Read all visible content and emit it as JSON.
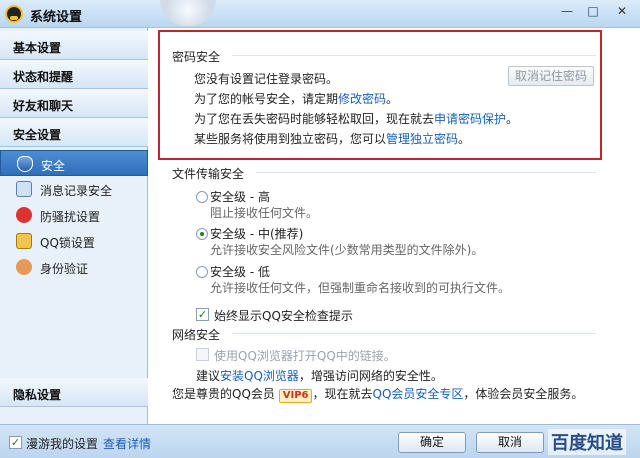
{
  "window": {
    "title": "系统设置",
    "minimize": "—",
    "maximize": "□",
    "close": "✕"
  },
  "sidebar": {
    "categories": [
      {
        "label": "基本设置"
      },
      {
        "label": "状态和提醒"
      },
      {
        "label": "好友和聊天"
      },
      {
        "label": "安全设置"
      }
    ],
    "items": [
      {
        "label": "安全",
        "icon": "shield-icon",
        "selected": true
      },
      {
        "label": "消息记录安全",
        "icon": "message-log-icon"
      },
      {
        "label": "防骚扰设置",
        "icon": "anti-harass-icon"
      },
      {
        "label": "QQ锁设置",
        "icon": "lock-icon"
      },
      {
        "label": "身份验证",
        "icon": "user-verify-icon"
      }
    ],
    "privacy": "隐私设置"
  },
  "password": {
    "title": "密码安全",
    "line1": "您没有设置记住登录密码。",
    "cancel_button": "取消记住密码",
    "line2_pre": "为了您的帐号安全，请定期",
    "line2_link": "修改密码",
    "line2_post": "。",
    "line3_pre": "为了您在丢失密码时能够轻松取回，现在就去",
    "line3_link": "申请密码保护",
    "line3_post": "。",
    "line4_pre": "某些服务将使用到独立密码，您可以",
    "line4_link": "管理独立密码",
    "line4_post": "。"
  },
  "file_transfer": {
    "title": "文件传输安全",
    "options": [
      {
        "label": "安全级 - 高",
        "desc": "阻止接收任何文件。",
        "selected": false
      },
      {
        "label": "安全级 - 中(推荐)",
        "desc": "允许接收安全风险文件(少数常用类型的文件除外)。",
        "selected": true
      },
      {
        "label": "安全级 - 低",
        "desc": "允许接收任何文件，但强制重命名接收到的可执行文件。",
        "selected": false
      }
    ],
    "always_show": "始终显示QQ安全检查提示",
    "always_show_checked": true
  },
  "network": {
    "title": "网络安全",
    "browser_option": "使用QQ浏览器打开QQ中的链接。",
    "suggest_pre": "建议",
    "suggest_link": "安装QQ浏览器",
    "suggest_post": "，增强访问网络的安全性。"
  },
  "member": {
    "pre": "您是尊贵的QQ会员",
    "vip": "VIP6",
    "mid": "，现在就去",
    "link": "QQ会员安全专区",
    "post": "，体验会员安全服务。"
  },
  "footer": {
    "roam_label": "漫游我的设置",
    "roam_checked": true,
    "detail_link": "查看详情",
    "ok": "确定",
    "cancel": "取消",
    "watermark": "百度知道"
  },
  "colors": {
    "highlight": "#c0272d",
    "link": "#1a5fb4",
    "selected": "#2f6fb9"
  }
}
